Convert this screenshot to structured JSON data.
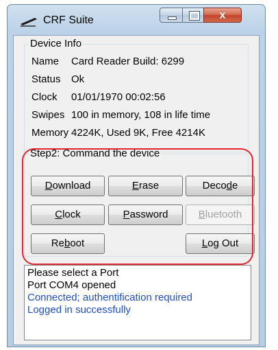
{
  "window": {
    "title": "CRF Suite",
    "controls": {
      "minimize": "—",
      "maximize": "□",
      "close": "x"
    }
  },
  "device_info": {
    "label": "Device Info",
    "rows": [
      {
        "key": "Name",
        "value": "Card Reader Build: 6299"
      },
      {
        "key": "Status",
        "value": "Ok"
      },
      {
        "key": "Clock",
        "value": "01/01/1970 00:02:56"
      },
      {
        "key": "Swipes",
        "value": "100 in memory, 108 in life time"
      },
      {
        "key": "Memory",
        "value": "4224K, Used 9K, Free 4214K"
      }
    ]
  },
  "command": {
    "label": "Step2: Command the device",
    "buttons": {
      "download": {
        "pre": "",
        "key": "D",
        "post": "ownload",
        "enabled": true
      },
      "erase": {
        "pre": "",
        "key": "E",
        "post": "rase",
        "enabled": true
      },
      "decode": {
        "pre": "Deco",
        "key": "d",
        "post": "e",
        "enabled": true
      },
      "clock": {
        "pre": "",
        "key": "C",
        "post": "lock",
        "enabled": true
      },
      "password": {
        "pre": "",
        "key": "P",
        "post": "assword",
        "enabled": true
      },
      "bluetooth": {
        "pre": "",
        "key": "B",
        "post": "luetooth",
        "enabled": false
      },
      "reboot": {
        "pre": "Re",
        "key": "b",
        "post": "oot",
        "enabled": true
      },
      "logout": {
        "pre": "",
        "key": "L",
        "post": "og Out",
        "enabled": true
      }
    }
  },
  "log": {
    "lines": [
      {
        "text": "Please select a Port",
        "color": "#000000"
      },
      {
        "text": "Port COM4 opened",
        "color": "#000000"
      },
      {
        "text": "Connected; authentification required",
        "color": "#1f4fc8"
      },
      {
        "text": "Logged in successfully",
        "color": "#1f4fc8"
      }
    ]
  },
  "colors": {
    "highlight_ring": "#e0262c",
    "log_info": "#1f4fc8"
  }
}
